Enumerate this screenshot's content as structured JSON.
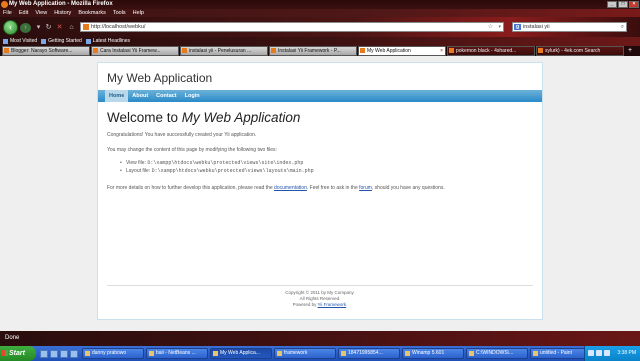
{
  "window": {
    "title": "My Web Application - Mozilla Firefox"
  },
  "menubar": [
    "File",
    "Edit",
    "View",
    "History",
    "Bookmarks",
    "Tools",
    "Help"
  ],
  "navbar": {
    "url": "http://localhost/webku/",
    "search_text": "instalasi yii"
  },
  "bookmarks": [
    "Most Visited",
    "Getting Started",
    "Latest Headlines"
  ],
  "tabs": [
    {
      "label": "Blogger: Narayo Software..."
    },
    {
      "label": "Cara Instalasi Yii Framew..."
    },
    {
      "label": "instalasi yii - Penelusuran ..."
    },
    {
      "label": "Instalasi Yii Framework - P..."
    },
    {
      "label": "My Web Application",
      "active": true
    },
    {
      "label": "pokemon black - 4shared..."
    },
    {
      "label": "sylurk) - 4ek.com Search"
    }
  ],
  "site": {
    "name": "My Web Application",
    "menu": [
      "Home",
      "About",
      "Contact",
      "Login"
    ],
    "heading_prefix": "Welcome to ",
    "heading_italic": "My Web Application",
    "intro": "Congratulations! You have successfully created your Yii application.",
    "change_text": "You may change the content of this page by modifying the following two files:",
    "files": [
      {
        "label": "View file: ",
        "path": "D:\\xampp\\htdocs\\webku\\protected\\views\\site\\index.php"
      },
      {
        "label": "Layout file: ",
        "path": "D:\\xampp\\htdocs\\webku\\protected\\views\\layouts\\main.php"
      }
    ],
    "details_pre": "For more details on how to further develop this application, please read the ",
    "details_link1": "documentation",
    "details_mid": ". Feel free to ask in the ",
    "details_link2": "forum",
    "details_post": ", should you have any questions.",
    "footer_copyright": "Copyright © 2011 by My Company.",
    "footer_rights": "All Rights Reserved.",
    "footer_powered": "Powered by ",
    "footer_powered_link": "Yii Framework",
    "footer_powered_end": "."
  },
  "status": "Done",
  "taskbar": {
    "start": "Start",
    "tasks": [
      {
        "label": "danny prabowo"
      },
      {
        "label": "baii - NetBeans ..."
      },
      {
        "label": "My Web Applica...",
        "active": true
      },
      {
        "label": "framework"
      },
      {
        "label": "18471995854..."
      },
      {
        "label": "Winamp 5.601"
      },
      {
        "label": "C:\\WINDOWS\\..."
      },
      {
        "label": "untitled - Paint"
      }
    ],
    "clock": "3:38 PM"
  }
}
